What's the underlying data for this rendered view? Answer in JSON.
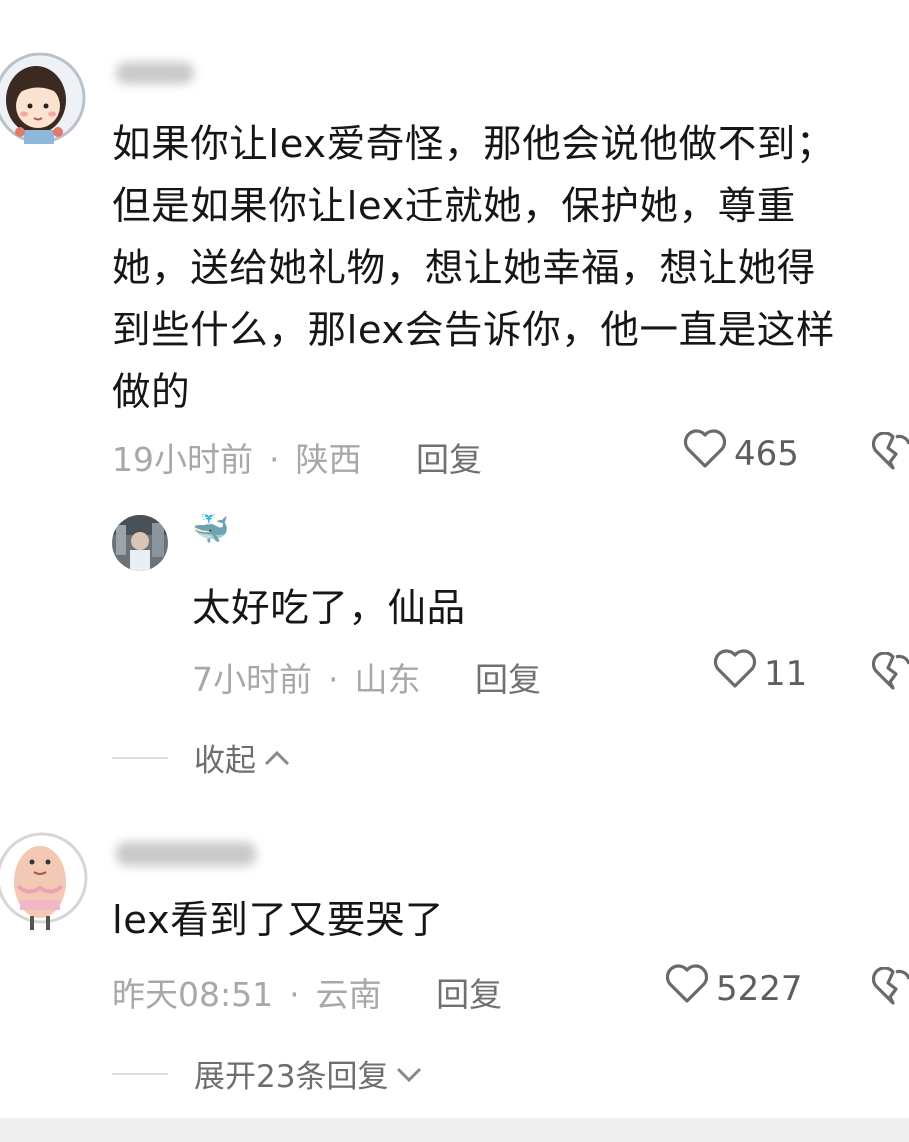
{
  "comments": [
    {
      "text_lines": [
        "如果你让lex爱奇怪，那他会说他做不到；",
        "但是如果你让lex迁就她，保护她，尊重",
        "她，送给她礼物，想让她幸福，想让她得",
        "到些什么，那lex会告诉你，他一直是这样",
        "做的"
      ],
      "time": "19小时前",
      "location": "陕西",
      "reply_label": "回复",
      "likes": "465",
      "replies": [
        {
          "username": "🐳",
          "text": "太好吃了，仙品",
          "time": "7小时前",
          "location": "山东",
          "reply_label": "回复",
          "likes": "11"
        }
      ],
      "thread_toggle": "收起"
    },
    {
      "text": "lex看到了又要哭了",
      "time": "昨天08:51",
      "location": "云南",
      "reply_label": "回复",
      "likes": "5227",
      "thread_toggle": "展开23条回复"
    }
  ],
  "separator": "·",
  "icons": {
    "like": "heart-outline-icon",
    "dislike": "broken-heart-icon",
    "collapse": "chevron-up-icon",
    "expand": "chevron-down-icon"
  }
}
